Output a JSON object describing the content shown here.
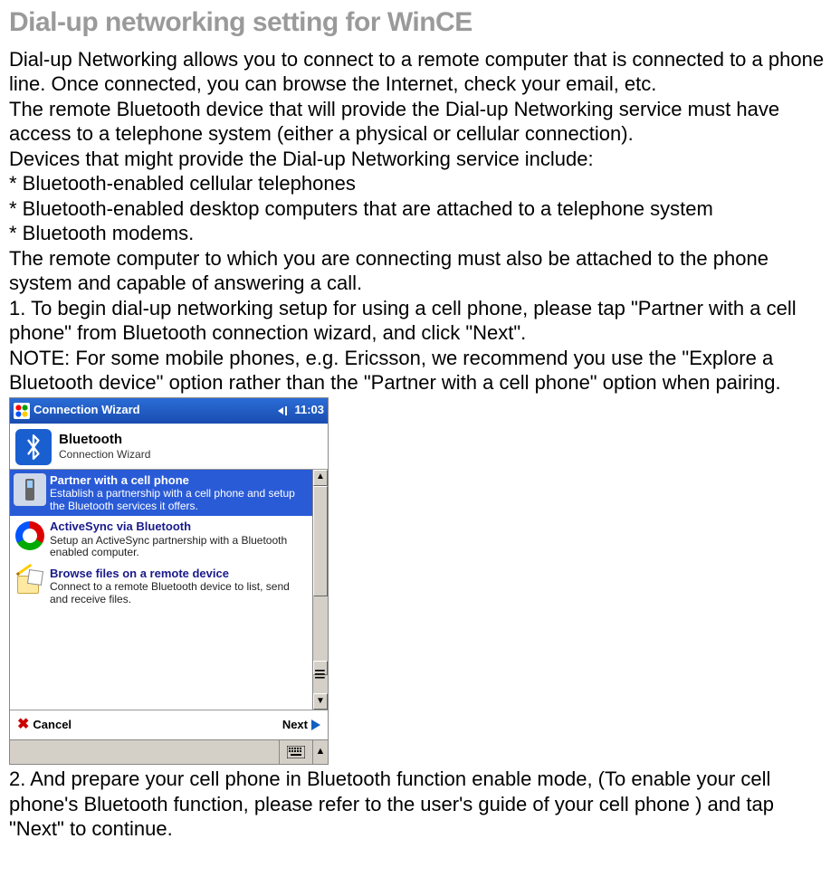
{
  "title": "Dial-up networking setting for WinCE",
  "para1": "Dial-up Networking allows you to connect to a remote computer that is connected to a phone line. Once connected, you can browse the Internet, check your email, etc.",
  "para2": "The remote Bluetooth device that will provide the Dial-up Networking service must have access to a telephone system (either a physical or cellular connection).",
  "para3": "Devices that might provide the Dial-up Networking service include:",
  "bul1": "* Bluetooth-enabled cellular telephones",
  "bul2": "* Bluetooth-enabled desktop computers that are attached to a telephone system",
  "bul3": "* Bluetooth modems.",
  "para4": "The remote computer to which you are connecting must also be attached to the phone system and capable of answering a call.",
  "step1": "1. To begin dial-up networking setup for using a cell phone, please tap \"Partner with a cell phone\" from Bluetooth connection wizard, and click \"Next\".",
  "note1": "NOTE: For some mobile phones, e.g. Ericsson, we recommend you use the \"Explore a Bluetooth device\" option rather than the \"Partner with a cell phone\" option when pairing.",
  "step2": "2. And prepare your cell phone in Bluetooth function enable mode, (To enable your cell phone's Bluetooth function, please refer to the user's guide of your cell phone ) and tap \"Next\" to continue.",
  "window": {
    "titlebar": "Connection Wizard",
    "time": "11:03",
    "header_title": "Bluetooth",
    "header_sub": "Connection Wizard",
    "items": [
      {
        "title": "Partner with a cell phone",
        "desc": "Establish a partnership with a cell phone and setup the Bluetooth services it offers."
      },
      {
        "title": "ActiveSync via Bluetooth",
        "desc": "Setup an ActiveSync partnership with a Bluetooth enabled computer."
      },
      {
        "title": "Browse files on a remote device",
        "desc": "Connect to a remote Bluetooth device to list, send and receive files."
      }
    ],
    "cancel": "Cancel",
    "next": "Next"
  }
}
